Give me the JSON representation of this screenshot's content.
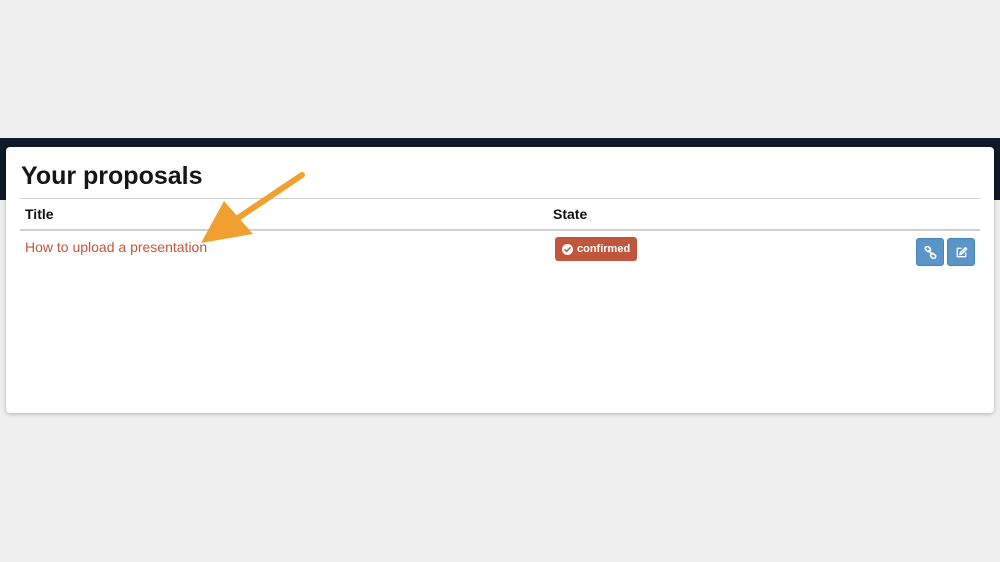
{
  "page": {
    "background_color": "#efefef",
    "banner_color": "#0f1a28"
  },
  "card": {
    "title": "Your proposals",
    "columns": {
      "title": "Title",
      "state": "State"
    },
    "rows": [
      {
        "title": "How to upload a presentation",
        "state": "confirmed",
        "state_icon": "check-circle-icon",
        "actions": [
          {
            "icon": "link-icon"
          },
          {
            "icon": "edit-icon"
          }
        ]
      }
    ]
  },
  "colors": {
    "link": "#c0573d",
    "badge": "#c0573d",
    "action_button": "#5a95c8",
    "annotation_arrow": "#f0a030"
  }
}
